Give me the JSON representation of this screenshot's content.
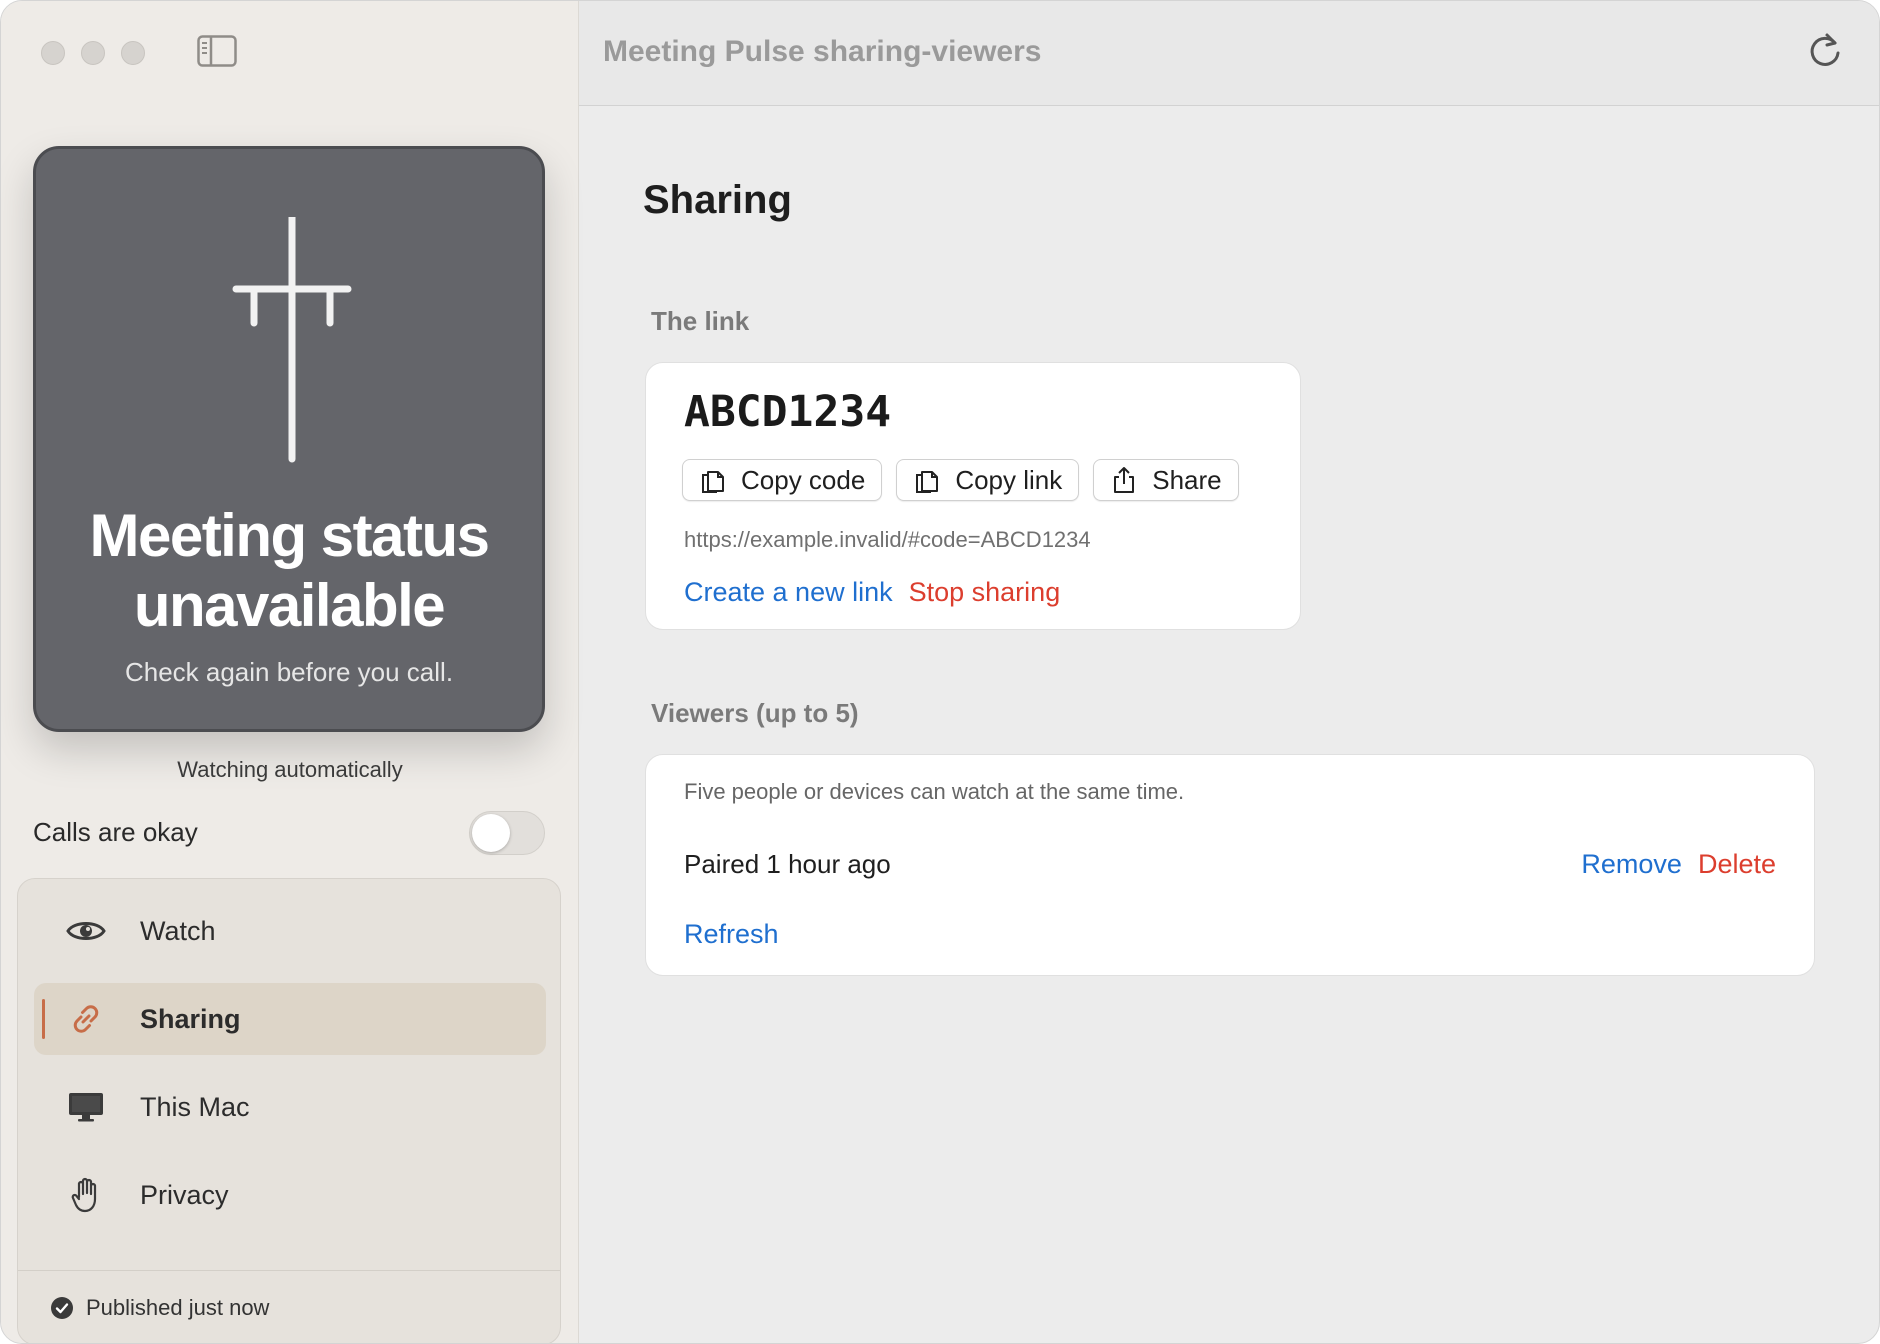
{
  "window": {
    "title": "Meeting Pulse sharing-viewers"
  },
  "sidebar": {
    "status_card": {
      "title_line1": "Meeting status",
      "title_line2": "unavailable",
      "subtitle": "Check again before you call."
    },
    "watching_label": "Watching automatically",
    "calls_toggle": {
      "label": "Calls are okay",
      "on": false
    },
    "nav": [
      {
        "label": "Watch",
        "icon": "eye-icon",
        "active": false
      },
      {
        "label": "Sharing",
        "icon": "link-icon",
        "active": true
      },
      {
        "label": "This Mac",
        "icon": "monitor-icon",
        "active": false
      },
      {
        "label": "Privacy",
        "icon": "hand-icon",
        "active": false
      }
    ],
    "footer_status": "Published just now",
    "accent_color": "#c76d48"
  },
  "main": {
    "page_title": "Sharing",
    "link_section": {
      "label": "The link",
      "code": "ABCD1234",
      "buttons": {
        "copy_code": "Copy code",
        "copy_link": "Copy link",
        "share": "Share"
      },
      "url": "https://example.invalid/#code=ABCD1234",
      "create_new_link": "Create a new link",
      "stop_sharing": "Stop sharing"
    },
    "viewers_section": {
      "label": "Viewers (up to 5)",
      "note": "Five people or devices can watch at the same time.",
      "viewers": [
        {
          "name": "Paired 1 hour ago",
          "remove": "Remove",
          "delete": "Delete"
        }
      ],
      "refresh": "Refresh"
    }
  },
  "colors": {
    "link_blue": "#1f6fcf",
    "destructive_red": "#dc3e2e"
  }
}
